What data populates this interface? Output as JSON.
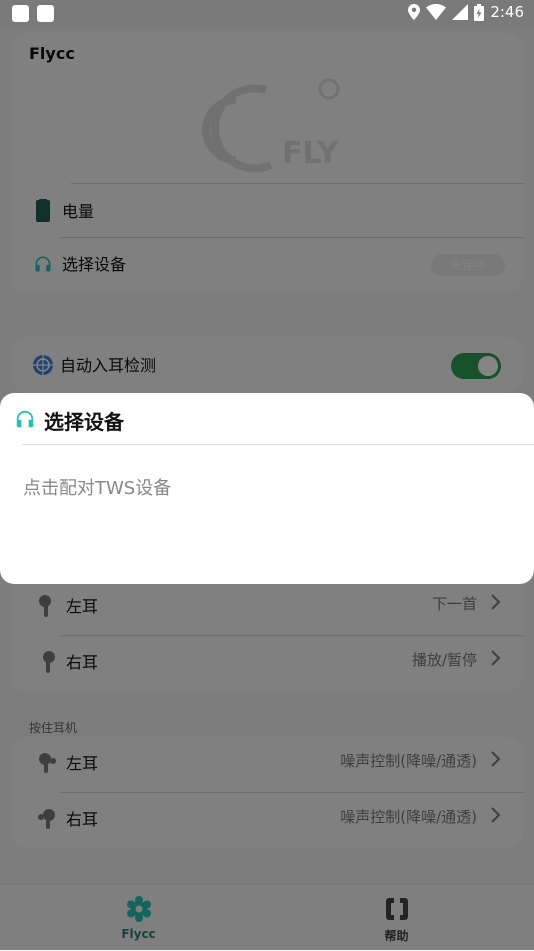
{
  "status_bar": {
    "time": "2:46"
  },
  "app": {
    "title": "Flycc"
  },
  "device_card": {
    "battery_label": "电量",
    "select_device_label": "选择设备",
    "select_device_badge": "未连接"
  },
  "features_card": {
    "auto_ear_detect_label": "自动入耳检测",
    "auto_ear_detect_on": true
  },
  "double_tap_card": {
    "left_label": "左耳",
    "left_value": "下一首",
    "right_label": "右耳",
    "right_value": "播放/暂停"
  },
  "hold_section": {
    "header": "按住耳机",
    "left_label": "左耳",
    "left_value": "噪声控制(降噪/通透)",
    "right_label": "右耳",
    "right_value": "噪声控制(降噪/通透)"
  },
  "dialog": {
    "title": "选择设备",
    "message": "点击配对TWS设备"
  },
  "bottom_nav": {
    "items": [
      {
        "label": "Flycc",
        "icon": "gear-flower-icon"
      },
      {
        "label": "帮助",
        "icon": "help-icon"
      }
    ]
  },
  "colors": {
    "accent": "#2abfb3",
    "switch_on": "#2e9e57",
    "battery_icon": "#1f5c55"
  }
}
